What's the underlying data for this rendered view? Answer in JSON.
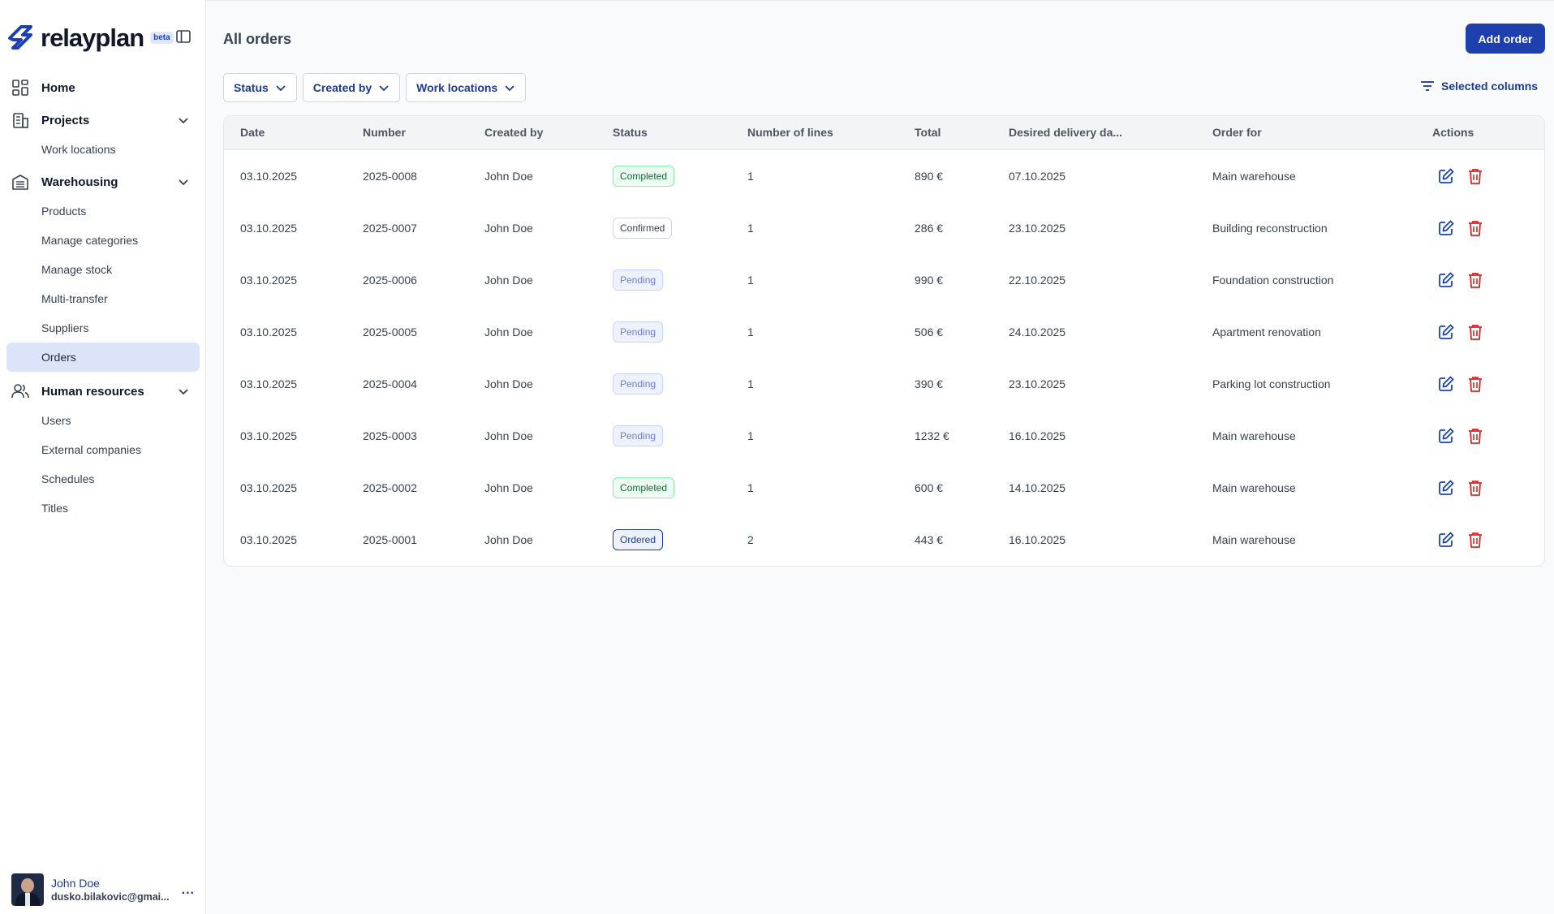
{
  "brand": {
    "name": "relayplan",
    "badge": "beta"
  },
  "sidebar": {
    "items": [
      {
        "label": "Home",
        "icon": "dashboard-icon"
      },
      {
        "label": "Projects",
        "icon": "building-icon",
        "children": [
          "Work locations"
        ]
      },
      {
        "label": "Warehousing",
        "icon": "warehouse-icon",
        "children": [
          "Products",
          "Manage categories",
          "Manage stock",
          "Multi-transfer",
          "Suppliers",
          "Orders"
        ]
      },
      {
        "label": "Human resources",
        "icon": "users-icon",
        "children": [
          "Users",
          "External companies",
          "Schedules",
          "Titles"
        ]
      }
    ],
    "active_item": "Orders"
  },
  "user": {
    "name": "John Doe",
    "email": "dusko.bilakovic@gmai...",
    "more": "..."
  },
  "header": {
    "title": "All orders",
    "add_button": "Add order"
  },
  "filters": [
    "Status",
    "Created by",
    "Work locations"
  ],
  "selected_columns_label": "Selected columns",
  "table": {
    "columns": [
      "Date",
      "Number",
      "Created by",
      "Status",
      "Number of lines",
      "Total",
      "Desired delivery da...",
      "Order for",
      "Actions"
    ],
    "rows": [
      {
        "date": "03.10.2025",
        "number": "2025-0008",
        "created_by": "John Doe",
        "status": "Completed",
        "status_key": "completed",
        "lines": "1",
        "total": "890 €",
        "delivery": "07.10.2025",
        "order_for": "Main warehouse"
      },
      {
        "date": "03.10.2025",
        "number": "2025-0007",
        "created_by": "John Doe",
        "status": "Confirmed",
        "status_key": "confirmed",
        "lines": "1",
        "total": "286 €",
        "delivery": "23.10.2025",
        "order_for": "Building reconstruction"
      },
      {
        "date": "03.10.2025",
        "number": "2025-0006",
        "created_by": "John Doe",
        "status": "Pending",
        "status_key": "pending",
        "lines": "1",
        "total": "990 €",
        "delivery": "22.10.2025",
        "order_for": "Foundation construction"
      },
      {
        "date": "03.10.2025",
        "number": "2025-0005",
        "created_by": "John Doe",
        "status": "Pending",
        "status_key": "pending",
        "lines": "1",
        "total": "506 €",
        "delivery": "24.10.2025",
        "order_for": "Apartment renovation"
      },
      {
        "date": "03.10.2025",
        "number": "2025-0004",
        "created_by": "John Doe",
        "status": "Pending",
        "status_key": "pending",
        "lines": "1",
        "total": "390 €",
        "delivery": "23.10.2025",
        "order_for": "Parking lot construction"
      },
      {
        "date": "03.10.2025",
        "number": "2025-0003",
        "created_by": "John Doe",
        "status": "Pending",
        "status_key": "pending",
        "lines": "1",
        "total": "1232 €",
        "delivery": "16.10.2025",
        "order_for": "Main warehouse"
      },
      {
        "date": "03.10.2025",
        "number": "2025-0002",
        "created_by": "John Doe",
        "status": "Completed",
        "status_key": "completed",
        "lines": "1",
        "total": "600 €",
        "delivery": "14.10.2025",
        "order_for": "Main warehouse"
      },
      {
        "date": "03.10.2025",
        "number": "2025-0001",
        "created_by": "John Doe",
        "status": "Ordered",
        "status_key": "ordered",
        "lines": "2",
        "total": "443 €",
        "delivery": "16.10.2025",
        "order_for": "Main warehouse"
      }
    ]
  },
  "colors": {
    "primary": "#1e40af",
    "active_nav": "#dbe4fb",
    "delete": "#dc2626",
    "edit": "#1e40af"
  }
}
